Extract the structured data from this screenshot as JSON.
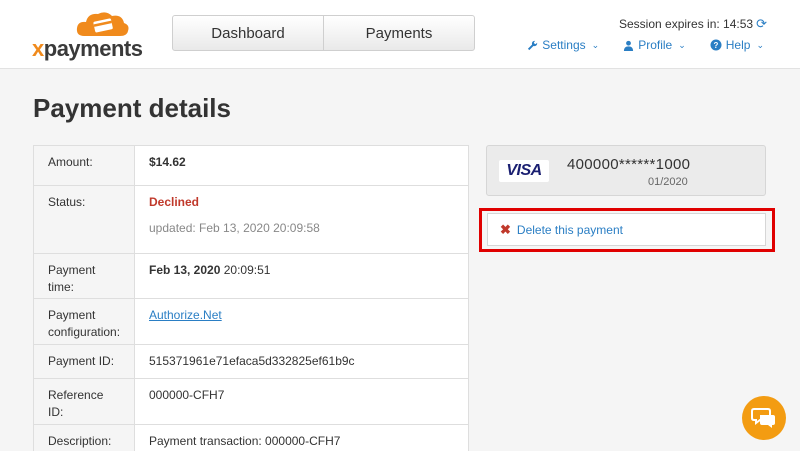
{
  "logo": {
    "text_x": "x",
    "text_rest": "payments"
  },
  "nav": {
    "tabs": [
      "Dashboard",
      "Payments"
    ]
  },
  "session": {
    "label": "Session expires in: 14:53"
  },
  "menu": {
    "settings": "Settings",
    "profile": "Profile",
    "help": "Help"
  },
  "page": {
    "title": "Payment details"
  },
  "details": {
    "amount_label": "Amount:",
    "amount_value": "$14.62",
    "status_label": "Status:",
    "status_value": "Declined",
    "status_updated": "updated: Feb 13, 2020 20:09:58",
    "time_label": "Payment time:",
    "time_date": "Feb 13, 2020",
    "time_clock": " 20:09:51",
    "config_label": "Payment configuration:",
    "config_value": "Authorize.Net",
    "id_label": "Payment ID:",
    "id_value": "515371961e71efaca5d332825ef61b9c",
    "ref_label": "Reference ID:",
    "ref_value": "000000-CFH7",
    "desc_label": "Description:",
    "desc_value": "Payment transaction: 000000-CFH7"
  },
  "card": {
    "brand": "VISA",
    "number": "400000******1000",
    "expiry": "01/2020"
  },
  "actions": {
    "delete_label": "Delete this payment"
  },
  "colors": {
    "accent": "#2a7ec4",
    "declined": "#c0392b",
    "brand_orange": "#f08a1c",
    "highlight": "#e00000",
    "chat": "#f39c12"
  }
}
